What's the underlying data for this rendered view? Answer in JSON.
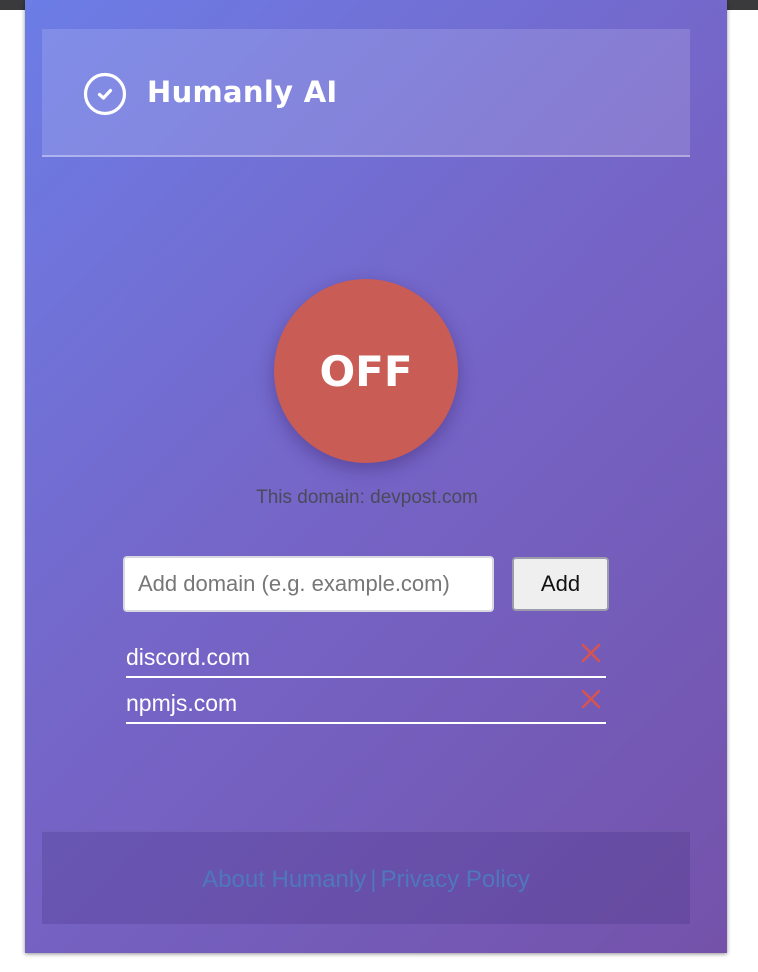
{
  "header": {
    "title": "Humanly AI",
    "icon": "check-circle-icon"
  },
  "toggle": {
    "label": "OFF",
    "state": "off",
    "color": "#c95c54"
  },
  "current_domain": {
    "text": "This domain: devpost.com"
  },
  "add_domain": {
    "placeholder": "Add domain (e.g. example.com)",
    "value": "",
    "button_label": "Add"
  },
  "domains": [
    {
      "name": "discord.com",
      "remove_icon": "close-icon"
    },
    {
      "name": "npmjs.com",
      "remove_icon": "close-icon"
    }
  ],
  "footer": {
    "about_label": "About Humanly",
    "separator": "|",
    "privacy_label": "Privacy Policy",
    "link_color": "#4f77bd"
  },
  "colors": {
    "gradient_start": "#6c7de6",
    "gradient_end": "#7452aa",
    "remove_color": "#d9534f"
  }
}
